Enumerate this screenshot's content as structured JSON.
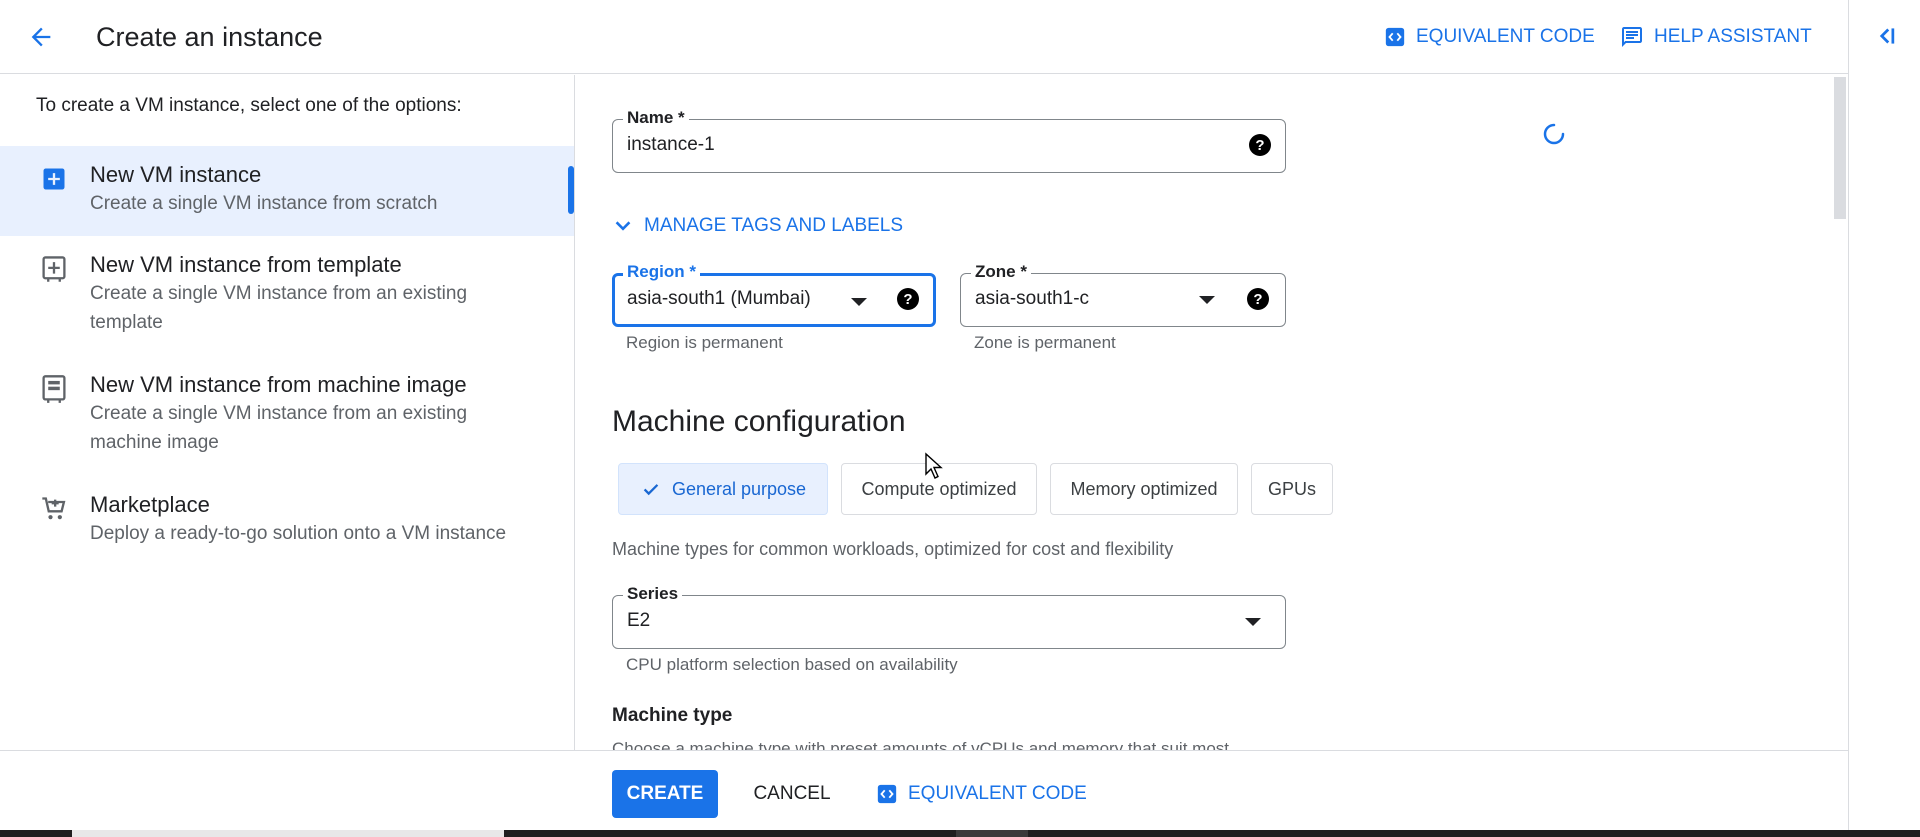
{
  "header": {
    "title": "Create an instance",
    "equivalent_code": "EQUIVALENT CODE",
    "help_assistant": "HELP ASSISTANT"
  },
  "left_panel": {
    "intro": "To create a VM instance, select one of the options:",
    "options": [
      {
        "title": "New VM instance",
        "desc": "Create a single VM instance from scratch",
        "icon": "add-box-icon",
        "selected": true
      },
      {
        "title": "New VM instance from template",
        "desc": "Create a single VM instance from an existing template",
        "icon": "add-template-icon",
        "selected": false
      },
      {
        "title": "New VM instance from machine image",
        "desc": "Create a single VM instance from an existing machine image",
        "icon": "machine-image-icon",
        "selected": false
      },
      {
        "title": "Marketplace",
        "desc": "Deploy a ready-to-go solution onto a VM instance",
        "icon": "cart-icon",
        "selected": false
      }
    ]
  },
  "form": {
    "name": {
      "label": "Name *",
      "value": "instance-1"
    },
    "manage_tags": "MANAGE TAGS AND LABELS",
    "region": {
      "label": "Region *",
      "value": "asia-south1 (Mumbai)",
      "hint": "Region is permanent"
    },
    "zone": {
      "label": "Zone *",
      "value": "asia-south1-c",
      "hint": "Zone is permanent"
    },
    "machine_config": {
      "title": "Machine configuration",
      "tabs": [
        "General purpose",
        "Compute optimized",
        "Memory optimized",
        "GPUs"
      ],
      "active_tab": "General purpose",
      "desc": "Machine types for common workloads, optimized for cost and flexibility"
    },
    "series": {
      "label": "Series",
      "value": "E2",
      "hint": "CPU platform selection based on availability"
    },
    "machine_type": {
      "heading": "Machine type",
      "desc": "Choose a machine type with preset amounts of vCPUs and memory that suit most"
    }
  },
  "footer": {
    "create": "CREATE",
    "cancel": "CANCEL",
    "equivalent_code": "EQUIVALENT CODE"
  },
  "colors": {
    "accent": "#1a73e8",
    "selected_bg": "#e8f0fe",
    "border": "#dadce0",
    "secondary_text": "#5f6368"
  }
}
